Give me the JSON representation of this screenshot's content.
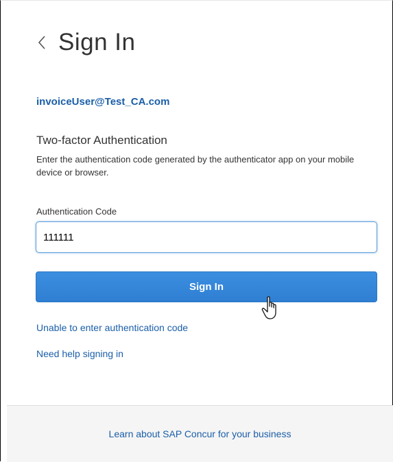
{
  "header": {
    "back_icon": "chevron-left-icon",
    "title": "Sign In"
  },
  "account": {
    "email": "invoiceUser@Test_CA.com"
  },
  "two_factor": {
    "heading": "Two-factor Authentication",
    "instructions": "Enter the authentication code generated by the authenticator app on your mobile device or browser."
  },
  "form": {
    "code_label": "Authentication Code",
    "code_value": "111111",
    "submit_label": "Sign In"
  },
  "links": {
    "unable": "Unable to enter authentication code",
    "help": "Need help signing in"
  },
  "footer": {
    "learn_more": "Learn about SAP Concur for your business"
  },
  "colors": {
    "link": "#1a5ea8",
    "button": "#2f7fd3",
    "input_focus_border": "#5b9bd5",
    "footer_bg": "#f5f5f5"
  },
  "cursor_icon": "hand-pointer-icon"
}
